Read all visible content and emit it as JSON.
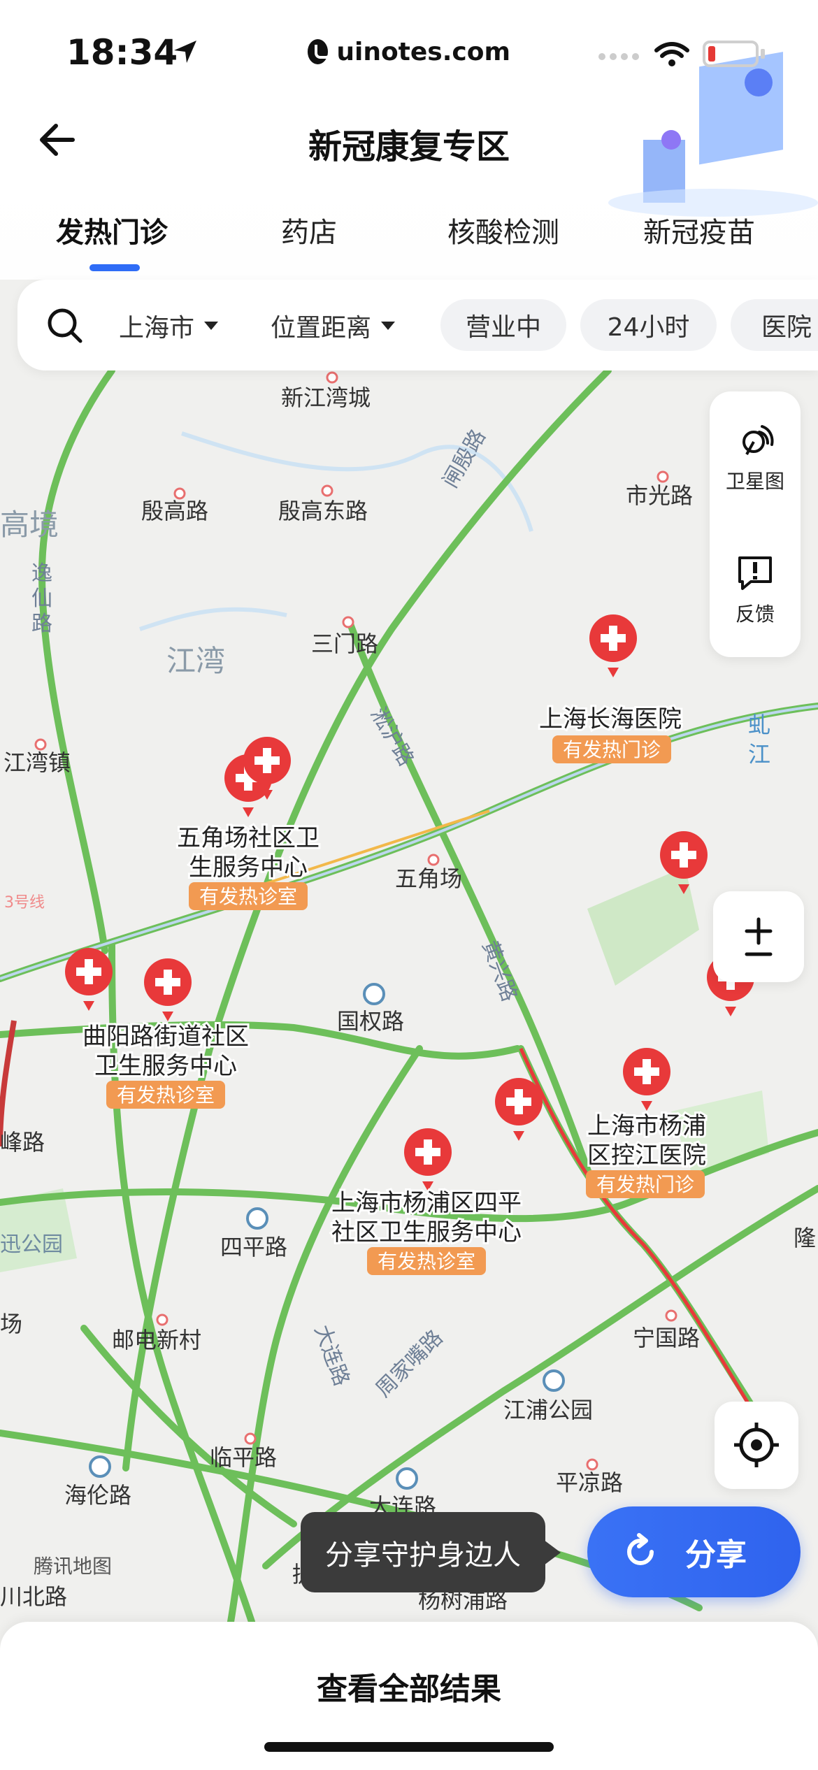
{
  "status_bar": {
    "time": "18:34",
    "url": "uinotes.com"
  },
  "header": {
    "title": "新冠康复专区",
    "back_icon": "arrow-left-icon"
  },
  "tabs": [
    {
      "label": "发热门诊",
      "active": true
    },
    {
      "label": "药店",
      "active": false
    },
    {
      "label": "核酸检测",
      "active": false
    },
    {
      "label": "新冠疫苗",
      "active": false
    }
  ],
  "filters": {
    "city": "上海市",
    "sort": "位置距离",
    "chips": [
      "营业中",
      "24小时",
      "医院"
    ]
  },
  "map_controls": {
    "satellite_label": "卫星图",
    "feedback_label": "反馈"
  },
  "map": {
    "road_labels": [
      "新江湾城",
      "殷高路",
      "殷高东路",
      "市光路",
      "三门路",
      "江湾",
      "江湾镇",
      "五角场",
      "国权路",
      "四平路",
      "邮电新村",
      "临平路",
      "海伦路",
      "大连路",
      "江浦公园",
      "平凉路",
      "宁国路",
      "杨树浦路",
      "提篮桥",
      "逸仙路",
      "高境",
      "淞沪路",
      "黄兴路",
      "周家嘴路",
      "大连路",
      "隆",
      "场",
      "峰路",
      "迅公园",
      "川北路",
      "虬江",
      "3号线",
      "腾讯地图"
    ],
    "places": [
      {
        "name": "上海长海医院",
        "tag": "有发热门诊"
      },
      {
        "name": "五角场社区卫生服务中心",
        "tag": "有发热诊室"
      },
      {
        "name": "曲阳路街道社区卫生服务中心",
        "tag": "有发热诊室"
      },
      {
        "name": "上海市杨浦区控江医院",
        "tag": "有发热门诊"
      },
      {
        "name": "上海市杨浦区四平社区卫生服务中心",
        "tag": "有发热诊室"
      }
    ]
  },
  "tooltip": "分享守护身边人",
  "share_label": "分享",
  "bottom": {
    "label": "查看全部结果"
  },
  "colors": {
    "accent": "#2f6cf6",
    "pin": "#e8393a",
    "tag": "#f29a52",
    "road": "#6dbf5a"
  }
}
